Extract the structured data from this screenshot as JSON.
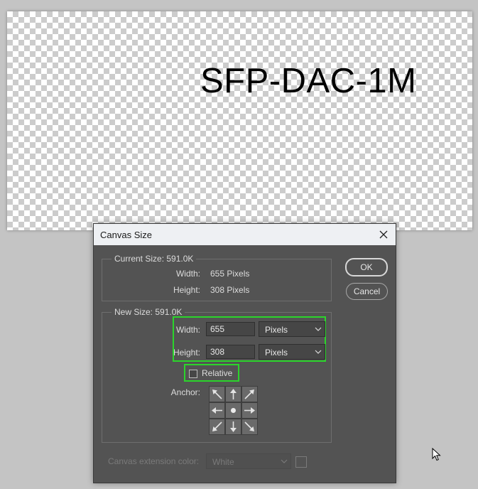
{
  "canvas": {
    "text": "SFP-DAC-1M"
  },
  "dialog": {
    "title": "Canvas Size",
    "current_size": {
      "legend": "Current Size: 591.0K",
      "width_label": "Width:",
      "width_value": "655 Pixels",
      "height_label": "Height:",
      "height_value": "308 Pixels"
    },
    "new_size": {
      "legend": "New Size: 591.0K",
      "width_label": "Width:",
      "width_value": "655",
      "width_unit": "Pixels",
      "height_label": "Height:",
      "height_value": "308",
      "height_unit": "Pixels",
      "relative_label": "Relative",
      "relative_checked": false,
      "anchor_label": "Anchor:"
    },
    "ok_label": "OK",
    "cancel_label": "Cancel",
    "extension": {
      "label": "Canvas extension color:",
      "value": "White"
    }
  },
  "colors": {
    "highlight": "#2bd42b",
    "dialog_bg": "#535353",
    "titlebar_bg": "#eef0f3"
  },
  "icons": {
    "close": "close-icon",
    "chevron": "chevron-down-icon",
    "anchor_arrows": [
      "arrow-up-left-icon",
      "arrow-up-icon",
      "arrow-up-right-icon",
      "arrow-left-icon",
      "anchor-center-dot-icon",
      "arrow-right-icon",
      "arrow-down-left-icon",
      "arrow-down-icon",
      "arrow-down-right-icon"
    ],
    "cursor": "mouse-cursor-icon"
  }
}
